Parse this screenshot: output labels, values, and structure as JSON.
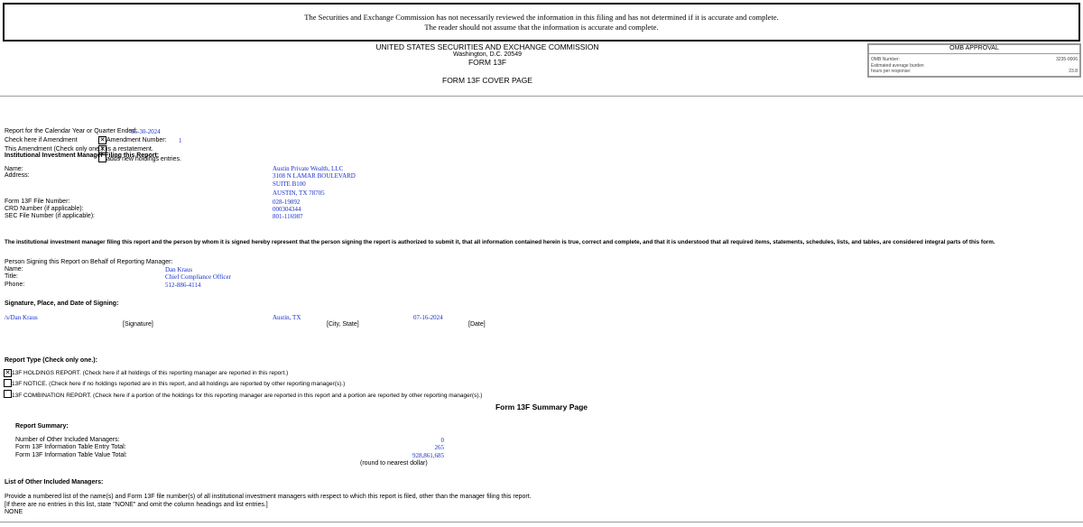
{
  "notice": {
    "line1": "The Securities and Exchange Commission has not necessarily reviewed the information in this filing and has not determined if it is accurate and complete.",
    "line2": "The reader should not assume that the information is accurate and complete."
  },
  "header": {
    "agency": "UNITED STATES SECURITIES AND EXCHANGE COMMISSION",
    "location": "Washington, D.C. 20549",
    "form": "FORM 13F",
    "cover_title": "FORM 13F COVER PAGE"
  },
  "omb": {
    "title": "OMB APPROVAL",
    "rows": [
      {
        "label": "OMB Number:",
        "value": "3235-0006"
      },
      {
        "label": "Estimated average burden",
        "value": ""
      },
      {
        "label": "hours per response:",
        "value": "23.8"
      }
    ]
  },
  "report_period": {
    "label": "Report for the Calendar Year or Quarter Ended:",
    "value": "06-30-2024",
    "amendment_label": "Check here if Amendment",
    "amendment_number_label": "Amendment Number:",
    "amendment_number": "1",
    "amendment_type_label": "This Amendment (Check only one.):",
    "restatement": "is a restatement.",
    "adds_new": "adds new holdings entries."
  },
  "manager": {
    "heading": "Institutional Investment Manager Filing this Report:",
    "name_label": "Name:",
    "name": "Austin Private Wealth, LLC",
    "address_label": "Address:",
    "address": [
      "3108 N LAMAR BOULEVARD",
      "SUITE B100",
      "AUSTIN, TX 78705"
    ],
    "file_number_label": "Form 13F File Number:",
    "file_number": "028-19892",
    "crd_label": "CRD Number (if applicable):",
    "crd": "000304344",
    "sec_label": "SEC File Number (if applicable):",
    "sec": "801-116987"
  },
  "representation": "The institutional investment manager filing this report and the person by whom it is signed hereby represent that the person signing the report is authorized to submit it, that all information contained herein is true, correct and complete, and that it is understood that all required items, statements, schedules, lists, and tables, are considered integral parts of this form.",
  "signer": {
    "heading": "Person Signing this Report on Behalf of Reporting Manager:",
    "name_label": "Name:",
    "name": "Dan Kraus",
    "title_label": "Title:",
    "title": "Chief Compliance Officer",
    "phone_label": "Phone:",
    "phone": "512-886-4114"
  },
  "signature": {
    "heading": "Signature, Place, and Date of Signing:",
    "signature": "/s/Dan Kraus",
    "signature_caption": "[Signature]",
    "place": "Austin, TX",
    "place_caption": "[City, State]",
    "date": "07-16-2024",
    "date_caption": "[Date]"
  },
  "report_type": {
    "heading": "Report Type (Check only one.):",
    "options": [
      "13F HOLDINGS REPORT. (Check here if all holdings of this reporting manager are reported in this report.)",
      "13F NOTICE. (Check here if no holdings reported are in this report, and all holdings are reported by other reporting manager(s).)",
      "13F COMBINATION REPORT. (Check here if a portion of the holdings for this reporting manager are reported in this report and a portion are reported by other reporting manager(s).)"
    ]
  },
  "summary": {
    "page_title": "Form 13F Summary Page",
    "heading": "Report Summary:",
    "other_managers_label": "Number of Other Included Managers:",
    "other_managers": "0",
    "entry_total_label": "Form 13F Information Table Entry Total:",
    "entry_total": "265",
    "value_total_label": "Form 13F Information Table Value Total:",
    "value_total": "928,861,685",
    "rounding": "(round to nearest dollar)"
  },
  "other_managers": {
    "heading": "List of Other Included Managers:",
    "instruction1": "Provide a numbered list of the name(s) and Form 13F file number(s) of all institutional investment managers with respect to which this report is filed, other than the manager filing this report.",
    "instruction2": "[If there are no entries in this list, state \"NONE\" and omit the column headings and list entries.]",
    "value": "NONE"
  }
}
